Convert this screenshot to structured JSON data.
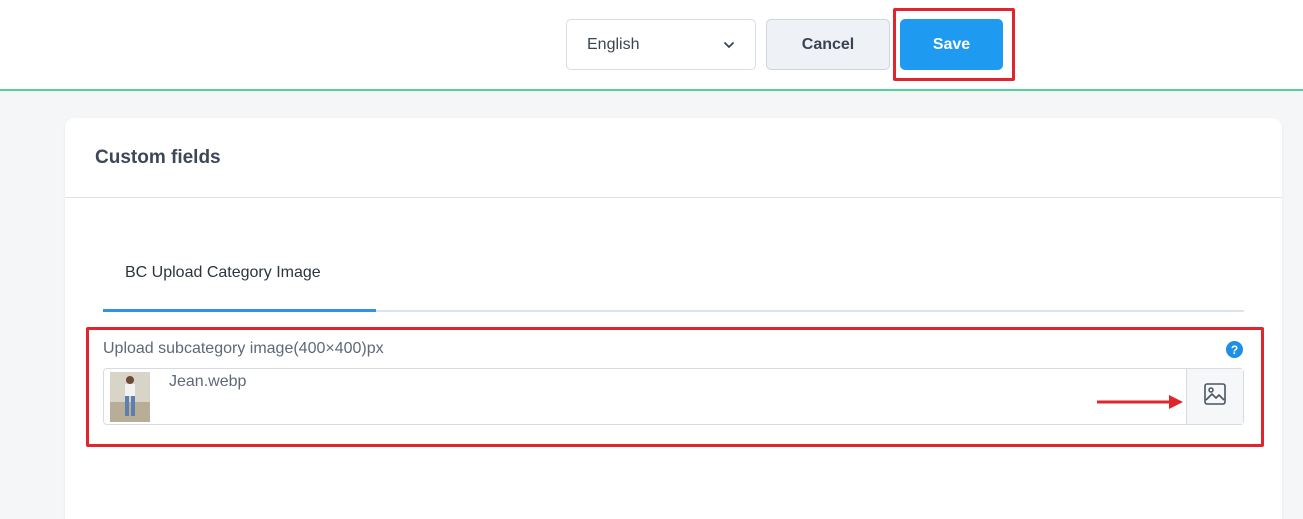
{
  "topbar": {
    "language": {
      "value": "English",
      "icon": "chevron-down-icon"
    },
    "cancel_label": "Cancel",
    "save_label": "Save"
  },
  "card": {
    "title": "Custom fields",
    "tabs": [
      {
        "label": "BC Upload Category Image",
        "active": true
      }
    ],
    "field": {
      "label": "Upload subcategory image(400×400)px",
      "help_icon": "?",
      "file_name": "Jean.webp",
      "browse_icon": "image-icon"
    }
  },
  "colors": {
    "accent": "#1e9bf0",
    "annotation": "#e0262c",
    "divider": "#4fd39a"
  }
}
